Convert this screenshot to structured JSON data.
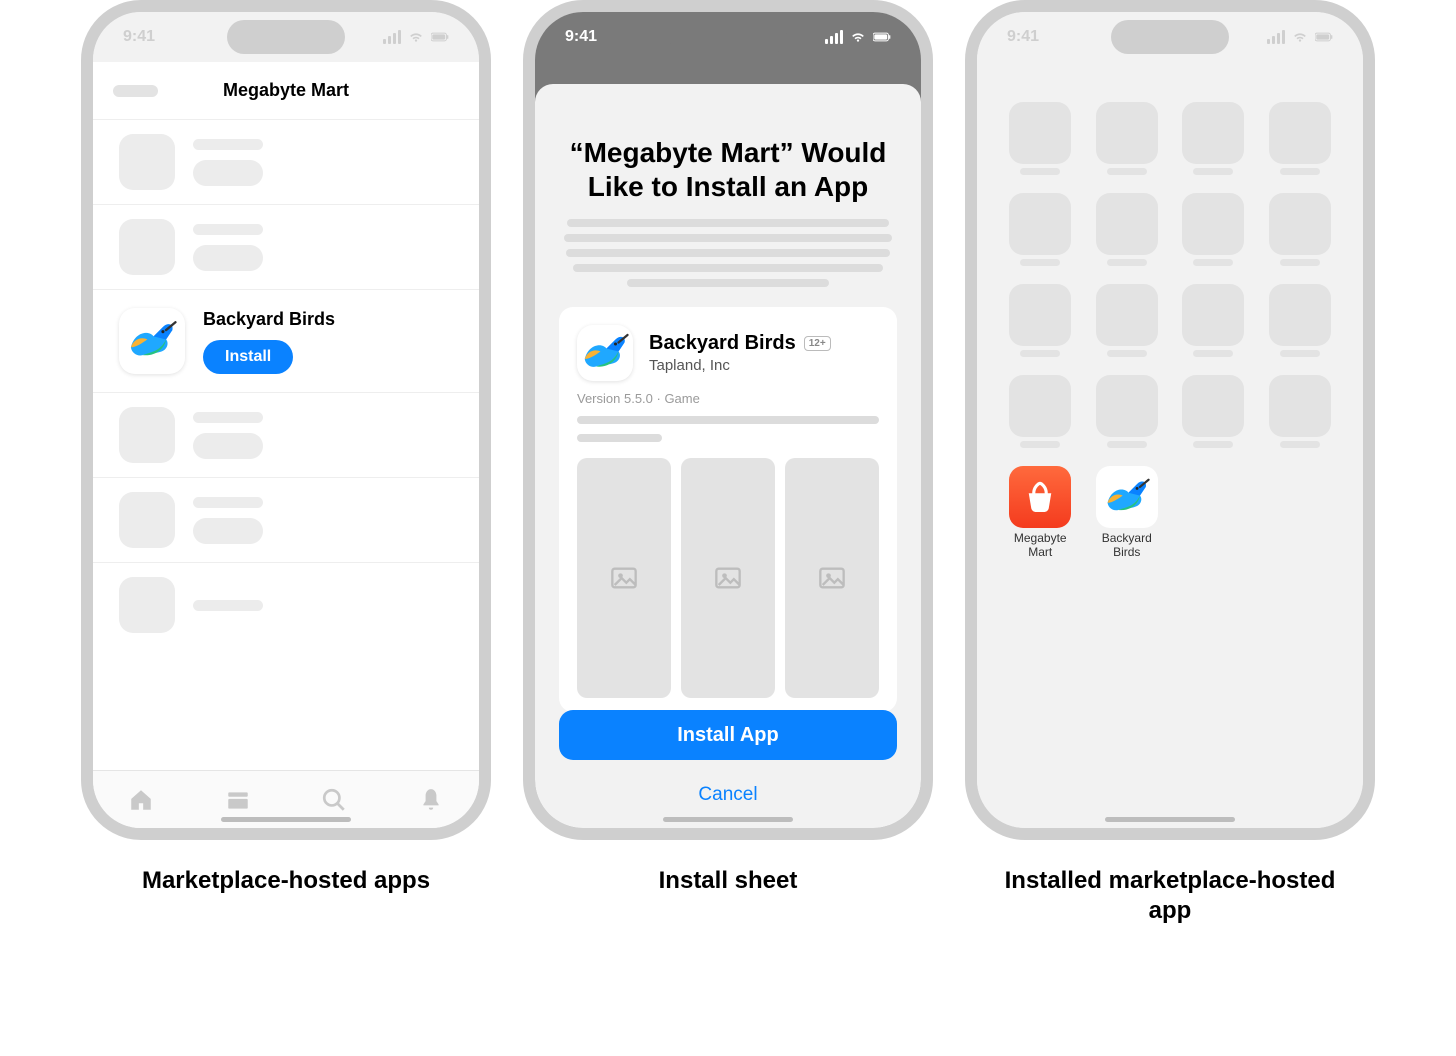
{
  "status": {
    "time": "9:41"
  },
  "captions": {
    "phone1": "Marketplace-hosted apps",
    "phone2": "Install sheet",
    "phone3": "Installed marketplace-hosted app"
  },
  "phone1": {
    "header_title": "Megabyte Mart",
    "app_name": "Backyard Birds",
    "install_label": "Install"
  },
  "phone2": {
    "headline": "“Megabyte Mart” Would Like to Install an App",
    "app_title": "Backyard Birds",
    "age_rating": "12+",
    "developer": "Tapland, Inc",
    "version_line": "Version 5.5.0 · Game",
    "install_label": "Install App",
    "cancel_label": "Cancel"
  },
  "phone3": {
    "apps": [
      {
        "name": "Megabyte Mart"
      },
      {
        "name": "Backyard Birds"
      }
    ]
  }
}
